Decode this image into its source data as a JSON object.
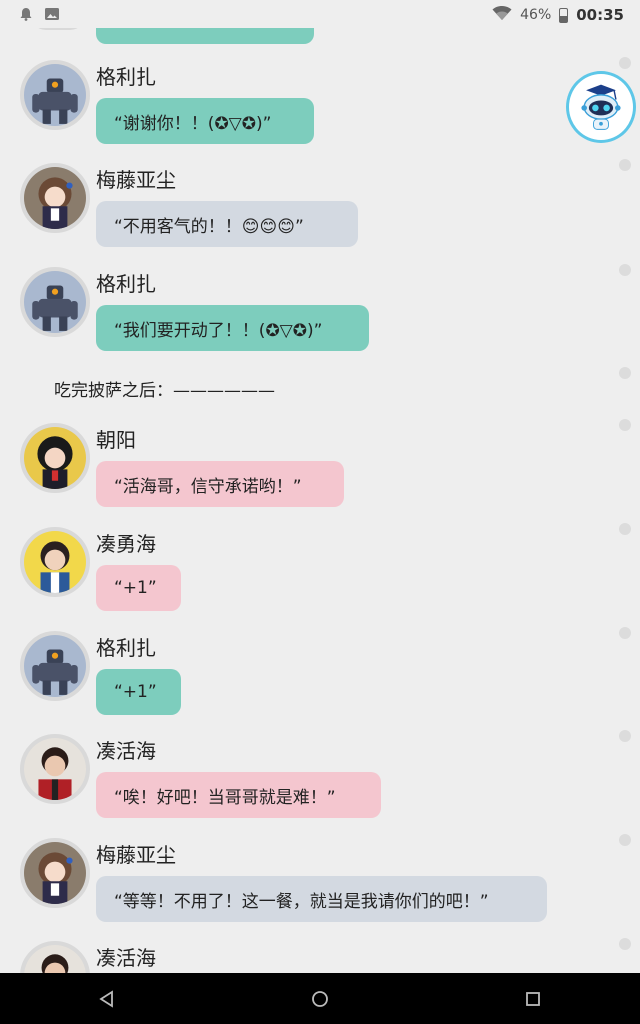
{
  "status_bar": {
    "battery_percent": "46%",
    "time": "00:35",
    "left_icons": [
      "notification-bell-icon",
      "image-icon"
    ],
    "right_icons": [
      "wifi-icon",
      "battery-icon"
    ]
  },
  "messages": [
    {
      "name": "格利扎",
      "text": "“谢谢你！！(✪▽✪)”",
      "color": "#7dcdbd",
      "avatar": "robot-avatar"
    },
    {
      "name": "梅藤亚尘",
      "text": "“不用客气的！！😊😊😊”",
      "color": "#d3d9e1",
      "avatar": "anime-girl-avatar"
    },
    {
      "name": "格利扎",
      "text": "“我们要开动了！！(✪▽✪)”",
      "color": "#7dcdbd",
      "avatar": "robot-avatar"
    },
    {
      "name": "朝阳",
      "text": "“活海哥，信守承诺哟！”",
      "color": "#f4c6cf",
      "avatar": "girl-avatar"
    },
    {
      "name": "凑勇海",
      "text": "“+1”",
      "color": "#f4c6cf",
      "avatar": "boy-avatar"
    },
    {
      "name": "格利扎",
      "text": "“+1”",
      "color": "#7dcdbd",
      "avatar": "robot-avatar"
    },
    {
      "name": "凑活海",
      "text": "“唉！好吧！当哥哥就是难！”",
      "color": "#f4c6cf",
      "avatar": "man-avatar"
    },
    {
      "name": "梅藤亚尘",
      "text": "“等等！不用了！这一餐，就当是我请你们的吧！”",
      "color": "#d3d9e1",
      "avatar": "anime-girl-avatar"
    },
    {
      "name": "凑活海",
      "text": "",
      "color": "#f4c6cf",
      "avatar": "man-avatar"
    }
  ],
  "narration": "吃完披萨之后：——————",
  "floating_assistant": {
    "icon": "robot-assistant-icon"
  },
  "nav_bar": {
    "buttons": [
      "back-icon",
      "home-icon",
      "recents-icon"
    ]
  }
}
